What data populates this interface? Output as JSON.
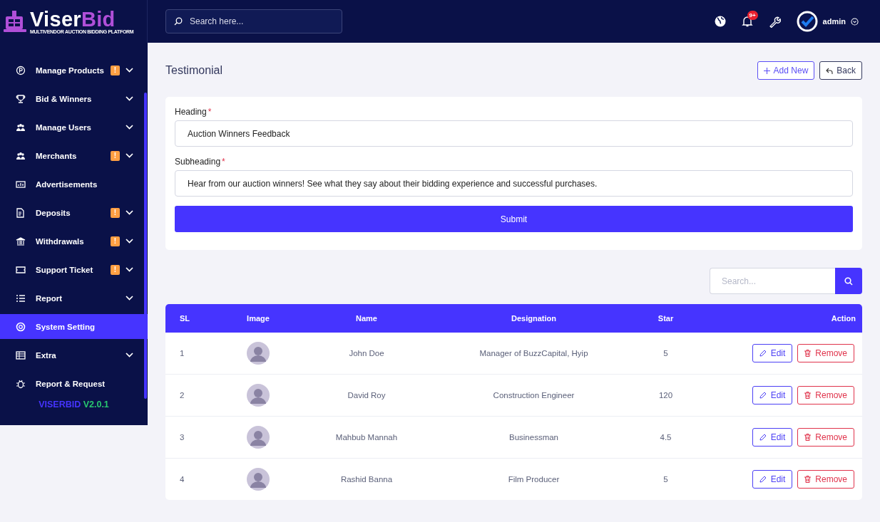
{
  "logo": {
    "name_main": "Viser",
    "name_accent": "Bid",
    "tagline": "MULTIVENDOR AUCTION BIDDING PLATFORM"
  },
  "topbar": {
    "search": {
      "placeholder": "Search here..."
    },
    "notification_badge": "9+",
    "user": "admin"
  },
  "sidebar": {
    "items": [
      {
        "label": "Manage Products",
        "badge": "!",
        "has_submenu": true,
        "selected": false
      },
      {
        "label": "Bid & Winners",
        "has_submenu": true,
        "selected": false
      },
      {
        "label": "Manage Users",
        "has_submenu": true,
        "selected": false
      },
      {
        "label": "Merchants",
        "badge": "!",
        "has_submenu": true,
        "selected": false
      },
      {
        "label": "Advertisements",
        "has_submenu": false,
        "selected": false
      },
      {
        "label": "Deposits",
        "badge": "!",
        "has_submenu": true,
        "selected": false
      },
      {
        "label": "Withdrawals",
        "badge": "!",
        "has_submenu": true,
        "selected": false
      },
      {
        "label": "Support Ticket",
        "badge": "!",
        "has_submenu": true,
        "selected": false
      },
      {
        "label": "Report",
        "has_submenu": true,
        "selected": false
      },
      {
        "label": "System Setting",
        "has_submenu": false,
        "selected": true
      },
      {
        "label": "Extra",
        "has_submenu": true,
        "selected": false
      },
      {
        "label": "Report & Request",
        "has_submenu": false,
        "selected": false
      }
    ],
    "version_name": "VISERBID",
    "version_number": "V2.0.1"
  },
  "page": {
    "title": "Testimonial",
    "buttons": {
      "add": "Add New",
      "back": "Back"
    }
  },
  "form": {
    "fields": [
      {
        "label": "Heading",
        "required_mark": "*",
        "value": "Auction Winners Feedback"
      },
      {
        "label": "Subheading",
        "required_mark": "*",
        "value": "Hear from our auction winners! See what they say about their bidding experience and successful purchases."
      }
    ],
    "submit": "Submit"
  },
  "table_search": {
    "placeholder": "Search..."
  },
  "table": {
    "columns": [
      "SL",
      "Image",
      "Name",
      "Designation",
      "Star",
      "Action"
    ],
    "rows": [
      {
        "sl": "1",
        "name": "John Doe",
        "designation": "Manager of BuzzCapital, Hyip",
        "star": "5",
        "edit": "Edit",
        "remove": "Remove"
      },
      {
        "sl": "2",
        "name": "David Roy",
        "designation": "Construction Engineer",
        "star": "120",
        "edit": "Edit",
        "remove": "Remove"
      },
      {
        "sl": "3",
        "name": "Mahbub Mannah",
        "designation": "Businessman",
        "star": "4.5",
        "edit": "Edit",
        "remove": "Remove"
      },
      {
        "sl": "4",
        "name": "Rashid Banna",
        "designation": "Film Producer",
        "star": "5",
        "edit": "Edit",
        "remove": "Remove"
      }
    ]
  }
}
